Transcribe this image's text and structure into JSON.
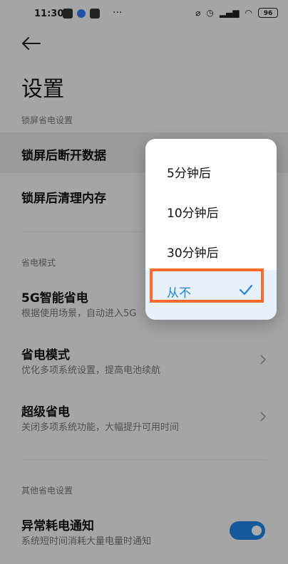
{
  "status_bar": {
    "time": "11:30",
    "dots": "···",
    "battery": "96",
    "right_icons": [
      "alarm-off-icon",
      "clock-icon",
      "signal-icon",
      "wifi-icon",
      "battery-icon"
    ],
    "left_icons": [
      "message-icon",
      "qq-icon",
      "tiktok-icon"
    ]
  },
  "header": {
    "title": "设置"
  },
  "sections": {
    "lock_power": {
      "label": "锁屏省电设置",
      "rows": [
        {
          "title": "锁屏后断开数据"
        },
        {
          "title": "锁屏后清理内存"
        }
      ]
    },
    "power_mode": {
      "label": "省电模式",
      "rows": [
        {
          "title": "5G智能省电",
          "subtitle": "根据使用场景，自动进入5G"
        },
        {
          "title": "省电模式",
          "subtitle": "优化多项系统设置，提高电池续航"
        },
        {
          "title": "超级省电",
          "subtitle": "关闭多项系统功能，大幅提升可用时间"
        }
      ]
    },
    "other": {
      "label": "其他省电设置",
      "rows": [
        {
          "title": "异常耗电通知",
          "subtitle": "系统短时间消耗大量电量时通知",
          "toggle_on": true
        }
      ]
    }
  },
  "dropdown": {
    "options": [
      "5分钟后",
      "10分钟后",
      "30分钟后",
      "从不"
    ],
    "selected": "从不"
  },
  "colors": {
    "accent": "#1f87e8",
    "highlight": "#ff6b2e"
  }
}
